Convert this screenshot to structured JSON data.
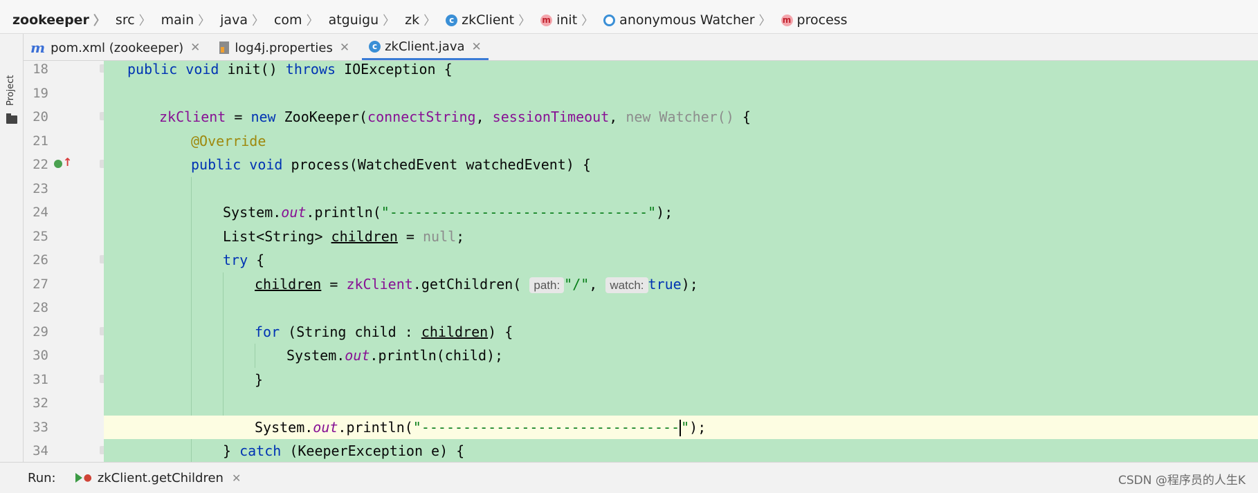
{
  "breadcrumb": [
    "zookeeper",
    "src",
    "main",
    "java",
    "com",
    "atguigu",
    "zk",
    "zkClient",
    "init",
    "anonymous Watcher",
    "process"
  ],
  "side_panel": {
    "label": "Project"
  },
  "tabs": [
    {
      "label": "pom.xml (zookeeper)",
      "icon": "maven-icon",
      "active": false
    },
    {
      "label": "log4j.properties",
      "icon": "properties-icon",
      "active": false
    },
    {
      "label": "zkClient.java",
      "icon": "java-class-icon",
      "active": true
    }
  ],
  "editor": {
    "lines": [
      "18",
      "19",
      "20",
      "21",
      "22",
      "23",
      "24",
      "25",
      "26",
      "27",
      "28",
      "29",
      "30",
      "31",
      "32",
      "33",
      "34"
    ],
    "current_line": "33",
    "param_hints": {
      "path": "path:",
      "watch": "watch:"
    }
  },
  "run_bar": {
    "label": "Run:",
    "config": "zkClient.getChildren"
  },
  "watermark": "CSDN @程序员的人生K",
  "colors": {
    "highlight": "#b9e6c4",
    "current_line": "#fdfde2",
    "keyword": "#0033b3",
    "string": "#067d17",
    "field": "#871094"
  }
}
